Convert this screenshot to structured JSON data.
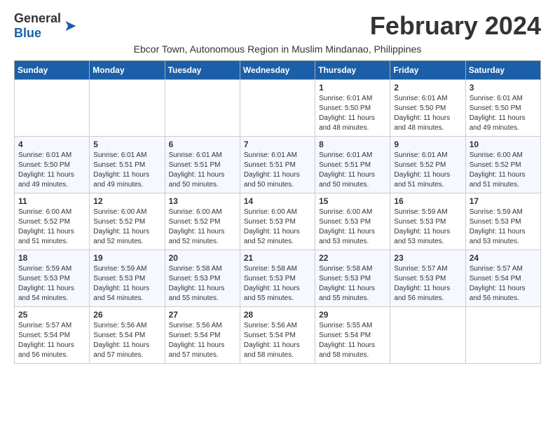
{
  "logo": {
    "general": "General",
    "blue": "Blue"
  },
  "month_title": "February 2024",
  "subtitle": "Ebcor Town, Autonomous Region in Muslim Mindanao, Philippines",
  "days_of_week": [
    "Sunday",
    "Monday",
    "Tuesday",
    "Wednesday",
    "Thursday",
    "Friday",
    "Saturday"
  ],
  "weeks": [
    [
      {
        "day": "",
        "info": ""
      },
      {
        "day": "",
        "info": ""
      },
      {
        "day": "",
        "info": ""
      },
      {
        "day": "",
        "info": ""
      },
      {
        "day": "1",
        "info": "Sunrise: 6:01 AM\nSunset: 5:50 PM\nDaylight: 11 hours\nand 48 minutes."
      },
      {
        "day": "2",
        "info": "Sunrise: 6:01 AM\nSunset: 5:50 PM\nDaylight: 11 hours\nand 48 minutes."
      },
      {
        "day": "3",
        "info": "Sunrise: 6:01 AM\nSunset: 5:50 PM\nDaylight: 11 hours\nand 49 minutes."
      }
    ],
    [
      {
        "day": "4",
        "info": "Sunrise: 6:01 AM\nSunset: 5:50 PM\nDaylight: 11 hours\nand 49 minutes."
      },
      {
        "day": "5",
        "info": "Sunrise: 6:01 AM\nSunset: 5:51 PM\nDaylight: 11 hours\nand 49 minutes."
      },
      {
        "day": "6",
        "info": "Sunrise: 6:01 AM\nSunset: 5:51 PM\nDaylight: 11 hours\nand 50 minutes."
      },
      {
        "day": "7",
        "info": "Sunrise: 6:01 AM\nSunset: 5:51 PM\nDaylight: 11 hours\nand 50 minutes."
      },
      {
        "day": "8",
        "info": "Sunrise: 6:01 AM\nSunset: 5:51 PM\nDaylight: 11 hours\nand 50 minutes."
      },
      {
        "day": "9",
        "info": "Sunrise: 6:01 AM\nSunset: 5:52 PM\nDaylight: 11 hours\nand 51 minutes."
      },
      {
        "day": "10",
        "info": "Sunrise: 6:00 AM\nSunset: 5:52 PM\nDaylight: 11 hours\nand 51 minutes."
      }
    ],
    [
      {
        "day": "11",
        "info": "Sunrise: 6:00 AM\nSunset: 5:52 PM\nDaylight: 11 hours\nand 51 minutes."
      },
      {
        "day": "12",
        "info": "Sunrise: 6:00 AM\nSunset: 5:52 PM\nDaylight: 11 hours\nand 52 minutes."
      },
      {
        "day": "13",
        "info": "Sunrise: 6:00 AM\nSunset: 5:52 PM\nDaylight: 11 hours\nand 52 minutes."
      },
      {
        "day": "14",
        "info": "Sunrise: 6:00 AM\nSunset: 5:53 PM\nDaylight: 11 hours\nand 52 minutes."
      },
      {
        "day": "15",
        "info": "Sunrise: 6:00 AM\nSunset: 5:53 PM\nDaylight: 11 hours\nand 53 minutes."
      },
      {
        "day": "16",
        "info": "Sunrise: 5:59 AM\nSunset: 5:53 PM\nDaylight: 11 hours\nand 53 minutes."
      },
      {
        "day": "17",
        "info": "Sunrise: 5:59 AM\nSunset: 5:53 PM\nDaylight: 11 hours\nand 53 minutes."
      }
    ],
    [
      {
        "day": "18",
        "info": "Sunrise: 5:59 AM\nSunset: 5:53 PM\nDaylight: 11 hours\nand 54 minutes."
      },
      {
        "day": "19",
        "info": "Sunrise: 5:59 AM\nSunset: 5:53 PM\nDaylight: 11 hours\nand 54 minutes."
      },
      {
        "day": "20",
        "info": "Sunrise: 5:58 AM\nSunset: 5:53 PM\nDaylight: 11 hours\nand 55 minutes."
      },
      {
        "day": "21",
        "info": "Sunrise: 5:58 AM\nSunset: 5:53 PM\nDaylight: 11 hours\nand 55 minutes."
      },
      {
        "day": "22",
        "info": "Sunrise: 5:58 AM\nSunset: 5:53 PM\nDaylight: 11 hours\nand 55 minutes."
      },
      {
        "day": "23",
        "info": "Sunrise: 5:57 AM\nSunset: 5:53 PM\nDaylight: 11 hours\nand 56 minutes."
      },
      {
        "day": "24",
        "info": "Sunrise: 5:57 AM\nSunset: 5:54 PM\nDaylight: 11 hours\nand 56 minutes."
      }
    ],
    [
      {
        "day": "25",
        "info": "Sunrise: 5:57 AM\nSunset: 5:54 PM\nDaylight: 11 hours\nand 56 minutes."
      },
      {
        "day": "26",
        "info": "Sunrise: 5:56 AM\nSunset: 5:54 PM\nDaylight: 11 hours\nand 57 minutes."
      },
      {
        "day": "27",
        "info": "Sunrise: 5:56 AM\nSunset: 5:54 PM\nDaylight: 11 hours\nand 57 minutes."
      },
      {
        "day": "28",
        "info": "Sunrise: 5:56 AM\nSunset: 5:54 PM\nDaylight: 11 hours\nand 58 minutes."
      },
      {
        "day": "29",
        "info": "Sunrise: 5:55 AM\nSunset: 5:54 PM\nDaylight: 11 hours\nand 58 minutes."
      },
      {
        "day": "",
        "info": ""
      },
      {
        "day": "",
        "info": ""
      }
    ]
  ]
}
